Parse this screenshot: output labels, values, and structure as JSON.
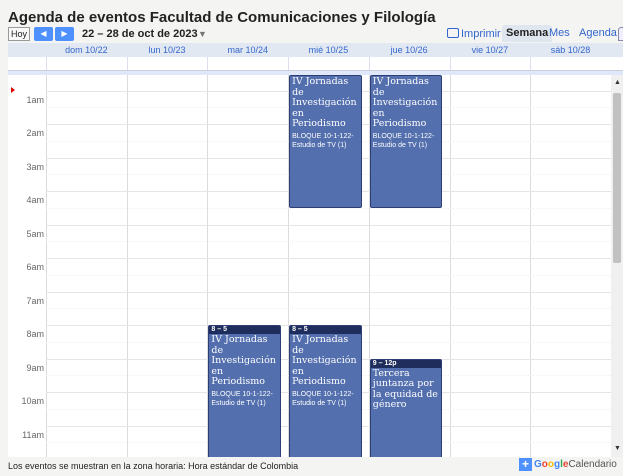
{
  "page": {
    "title": "Agenda de eventos Facultad de Comunicaciones y Filología"
  },
  "toolbar": {
    "today_label": "Hoy",
    "prev_symbol": "◀",
    "next_symbol": "▶",
    "date_range": "22 – 28 de oct de 2023",
    "range_caret": "▼",
    "print_label": "Imprimir",
    "views": {
      "week": "Semana",
      "month": "Mes",
      "agenda": "Agenda"
    },
    "active_view": "week"
  },
  "days": [
    "dom 10/22",
    "lun 10/23",
    "mar 10/24",
    "mié 10/25",
    "jue 10/26",
    "vie 10/27",
    "sáb 10/28"
  ],
  "hours": [
    "1am",
    "2am",
    "3am",
    "4am",
    "5am",
    "6am",
    "7am",
    "8am",
    "9am",
    "10am",
    "11am"
  ],
  "events": [
    {
      "day_index": 3,
      "start": "00:00",
      "end": "04:30",
      "time_label": "",
      "title": "IV Jornadas de Investigación en Periodismo",
      "location": "BLOQUE 10-1-122-Estudio de TV (1)"
    },
    {
      "day_index": 4,
      "start": "00:00",
      "end": "04:30",
      "time_label": "",
      "title": "IV Jornadas de Investigación en Periodismo",
      "location": "BLOQUE 10-1-122-Estudio de TV (1)"
    },
    {
      "day_index": 2,
      "start": "08:00",
      "end": "12:00",
      "time_label": "8 – 5",
      "title": "IV Jornadas de Investigación en Periodismo",
      "location": "BLOQUE 10-1-122-Estudio de TV (1)"
    },
    {
      "day_index": 3,
      "start": "08:00",
      "end": "12:00",
      "time_label": "8 – 5",
      "title": "IV Jornadas de Investigación en Periodismo",
      "location": "BLOQUE 10-1-122-Estudio de TV (1)"
    },
    {
      "day_index": 4,
      "start": "09:00",
      "end": "12:00",
      "time_label": "9 – 12p",
      "title": "Tercera juntanza por la equidad de género",
      "location": ""
    }
  ],
  "footer": {
    "timezone_note": "Los eventos se muestran en la zona horaria: Hora estándar de Colombia",
    "badge_google": "Google",
    "badge_calendar": "Calendario"
  },
  "colors": {
    "event_fill": "#536fae",
    "event_header": "#1f2d5c",
    "accent": "#4d90fe",
    "link": "#3366cc"
  },
  "icons": [
    "previous-icon",
    "next-icon",
    "caret-down-icon",
    "printer-icon",
    "add-icon"
  ]
}
